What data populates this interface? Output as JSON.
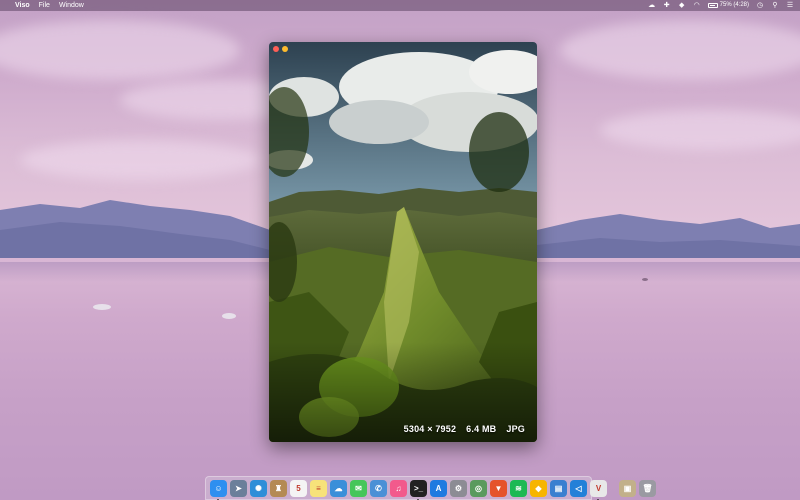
{
  "menubar": {
    "app_name": "Viso",
    "menus": [
      "File",
      "Window"
    ],
    "battery_text": "75% (4:28)",
    "status_icons": [
      "creative-cloud-icon",
      "plus-icon",
      "dropbox-icon",
      "wifi-icon",
      "battery-icon",
      "clock-icon",
      "search-icon",
      "control-center-icon"
    ]
  },
  "viewer": {
    "dimensions": "5304 × 7952",
    "file_size": "6.4 MB",
    "format": "JPG"
  },
  "dock": {
    "apps": [
      {
        "name": "finder-icon",
        "glyph": "☺",
        "color": "#2e8ff0",
        "running": true
      },
      {
        "name": "compass-icon",
        "glyph": "➤",
        "color": "#6b7f9a",
        "running": false
      },
      {
        "name": "safari-icon",
        "glyph": "✺",
        "color": "#2f8ed8",
        "running": false
      },
      {
        "name": "contacts-icon",
        "glyph": "♜",
        "color": "#b48a54",
        "running": false
      },
      {
        "name": "calendar-icon",
        "glyph": "5",
        "color": "#f4f4f4",
        "running": false
      },
      {
        "name": "notes-icon",
        "glyph": "≡",
        "color": "#f7e27a",
        "running": false
      },
      {
        "name": "cloud-icon",
        "glyph": "☁",
        "color": "#3a8fd9",
        "running": false
      },
      {
        "name": "messages-icon",
        "glyph": "✉",
        "color": "#46c65a",
        "running": false
      },
      {
        "name": "messaging-icon",
        "glyph": "✆",
        "color": "#4a90d6",
        "running": false
      },
      {
        "name": "itunes-icon",
        "glyph": "♫",
        "color": "#f25a8c",
        "running": false
      },
      {
        "name": "terminal-icon",
        "glyph": ">_",
        "color": "#222222",
        "running": true
      },
      {
        "name": "app-store-icon",
        "glyph": "A",
        "color": "#1f7ae0",
        "running": false
      },
      {
        "name": "settings-icon",
        "glyph": "⚙",
        "color": "#8c8c94",
        "running": false
      },
      {
        "name": "globe-icon",
        "glyph": "◎",
        "color": "#5a9a5e",
        "running": false
      },
      {
        "name": "brave-icon",
        "glyph": "▼",
        "color": "#e5532b",
        "running": false
      },
      {
        "name": "spotify-icon",
        "glyph": "≋",
        "color": "#1db954",
        "running": false
      },
      {
        "name": "sketch-icon",
        "glyph": "◆",
        "color": "#f7b500",
        "running": false
      },
      {
        "name": "files-icon",
        "glyph": "▤",
        "color": "#3a7fd0",
        "running": false
      },
      {
        "name": "vscode-icon",
        "glyph": "◁",
        "color": "#2380d8",
        "running": false
      },
      {
        "name": "vivaldi-icon",
        "glyph": "V",
        "color": "#e8e8e8",
        "running": true
      }
    ],
    "trailing": [
      {
        "name": "archive-icon",
        "glyph": "▣",
        "color": "#c2b08a",
        "running": false
      },
      {
        "name": "trash-icon",
        "glyph": "🗑",
        "color": "#9a9aa2",
        "running": false
      }
    ]
  }
}
